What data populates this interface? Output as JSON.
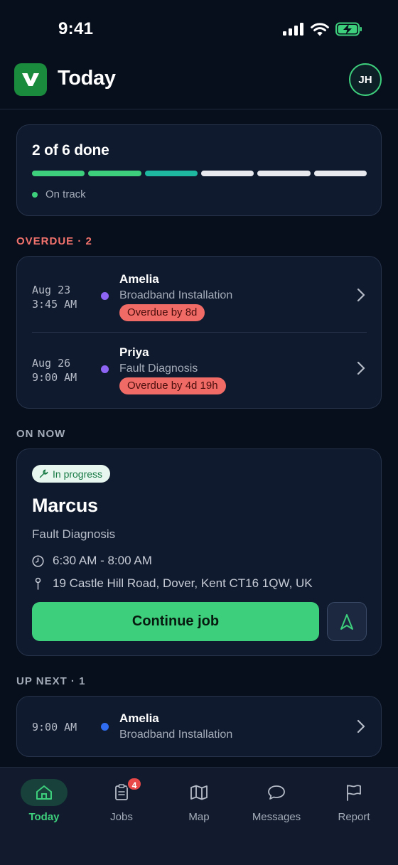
{
  "status_bar": {
    "time": "9:41"
  },
  "header": {
    "title": "Today",
    "avatar_initials": "JH",
    "logo_glyph": "V"
  },
  "progress": {
    "title": "2 of 6 done",
    "status": "On track",
    "done": 2,
    "total": 6,
    "segments": [
      "done",
      "done",
      "current",
      "pending",
      "pending",
      "pending"
    ]
  },
  "overdue": {
    "label": "OVERDUE · 2",
    "jobs": [
      {
        "date": "Aug 23",
        "time": "3:45 AM",
        "name": "Amelia",
        "service": "Broadband Installation",
        "overdue": "Overdue by 8d"
      },
      {
        "date": "Aug 26",
        "time": "9:00 AM",
        "name": "Priya",
        "service": "Fault Diagnosis",
        "overdue": "Overdue by 4d 19h"
      }
    ]
  },
  "on_now": {
    "label": "ON NOW",
    "status": "In progress",
    "name": "Marcus",
    "service": "Fault Diagnosis",
    "time_range": "6:30 AM - 8:00 AM",
    "address": "19 Castle Hill Road, Dover, Kent CT16 1QW, UK",
    "continue_label": "Continue job"
  },
  "up_next": {
    "label": "UP NEXT · 1",
    "jobs": [
      {
        "time": "9:00 AM",
        "name": "Amelia",
        "service": "Broadband Installation"
      }
    ]
  },
  "tabs": [
    {
      "label": "Today",
      "icon": "home-icon",
      "active": true
    },
    {
      "label": "Jobs",
      "icon": "clipboard-icon",
      "badge": "4"
    },
    {
      "label": "Map",
      "icon": "map-icon"
    },
    {
      "label": "Messages",
      "icon": "chat-icon"
    },
    {
      "label": "Report",
      "icon": "flag-icon"
    }
  ],
  "colors": {
    "background": "#070e1c",
    "card": "#0f1a2e",
    "accent_green": "#3ecf7c",
    "overdue_red": "#f06b66",
    "purple_dot": "#8e64f5",
    "blue_dot": "#2f6cf0"
  }
}
